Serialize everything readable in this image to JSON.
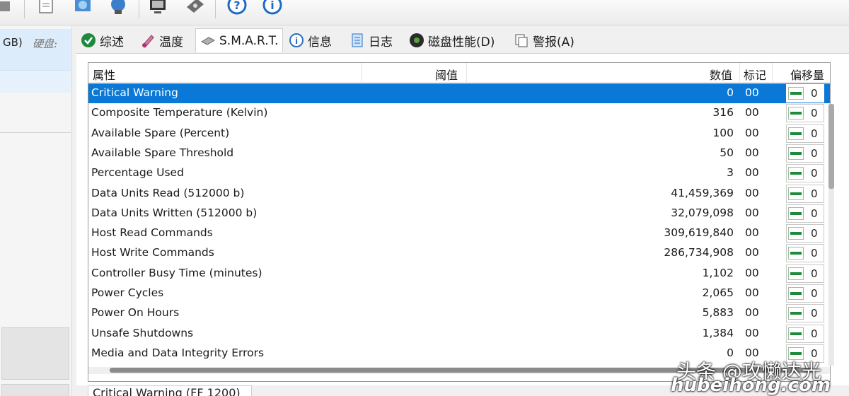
{
  "left_panel": {
    "drive_size": "GB)",
    "drive_label": "硬盘:"
  },
  "tabs": [
    {
      "label": "综述",
      "icon": "check-circle-icon"
    },
    {
      "label": "温度",
      "icon": "thermometer-icon"
    },
    {
      "label": "S.M.A.R.T.",
      "icon": "drive-icon",
      "active": true
    },
    {
      "label": "信息",
      "icon": "info-icon"
    },
    {
      "label": "日志",
      "icon": "log-icon"
    },
    {
      "label": "磁盘性能(D)",
      "icon": "disk-performance-icon"
    },
    {
      "label": "警报(A)",
      "icon": "alert-icon"
    }
  ],
  "table": {
    "headers": {
      "attribute": "属性",
      "threshold": "阈值",
      "value": "数值",
      "flag": "标记",
      "offset": "偏移量"
    },
    "rows": [
      {
        "name": "Critical Warning",
        "value": "0",
        "flag": "00",
        "offset": "0",
        "selected": true
      },
      {
        "name": "Composite Temperature (Kelvin)",
        "value": "316",
        "flag": "00",
        "offset": "0"
      },
      {
        "name": "Available Spare (Percent)",
        "value": "100",
        "flag": "00",
        "offset": "0"
      },
      {
        "name": "Available Spare Threshold",
        "value": "50",
        "flag": "00",
        "offset": "0"
      },
      {
        "name": "Percentage Used",
        "value": "3",
        "flag": "00",
        "offset": "0"
      },
      {
        "name": "Data Units Read (512000 b)",
        "value": "41,459,369",
        "flag": "00",
        "offset": "0"
      },
      {
        "name": "Data Units Written (512000 b)",
        "value": "32,079,098",
        "flag": "00",
        "offset": "0"
      },
      {
        "name": "Host Read Commands",
        "value": "309,619,840",
        "flag": "00",
        "offset": "0"
      },
      {
        "name": "Host Write Commands",
        "value": "286,734,908",
        "flag": "00",
        "offset": "0"
      },
      {
        "name": "Controller Busy Time (minutes)",
        "value": "1,102",
        "flag": "00",
        "offset": "0"
      },
      {
        "name": "Power Cycles",
        "value": "2,065",
        "flag": "00",
        "offset": "0"
      },
      {
        "name": "Power On Hours",
        "value": "5,883",
        "flag": "00",
        "offset": "0"
      },
      {
        "name": "Unsafe Shutdowns",
        "value": "1,384",
        "flag": "00",
        "offset": "0"
      },
      {
        "name": "Media and Data Integrity Errors",
        "value": "0",
        "flag": "00",
        "offset": "0"
      }
    ]
  },
  "bottom_caption": "Critical Warning (FF 1200)",
  "watermark": {
    "line1": "头条 @攻懒达光",
    "line2": "hubeihong.com"
  },
  "colors": {
    "selection": "#0a78d7",
    "offset_indicator": "#1e8a3a"
  }
}
